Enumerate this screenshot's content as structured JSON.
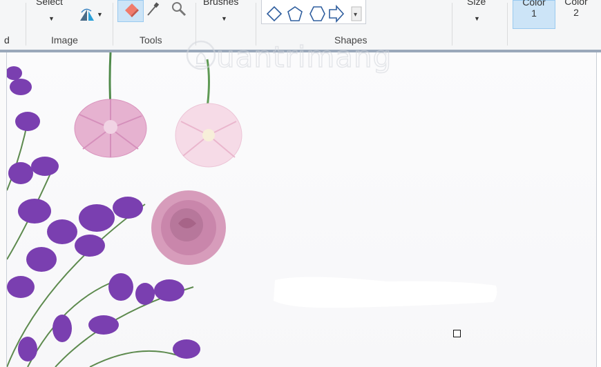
{
  "ribbon": {
    "cut_labels": {
      "select": "Select",
      "brushes": "Brushes",
      "size": "Size",
      "color1_label": "Color",
      "color1_num": "1",
      "color2_label": "Color",
      "color2_num": "2",
      "left_cut": "d"
    },
    "groups": {
      "image": "Image",
      "tools": "Tools",
      "shapes": "Shapes"
    }
  },
  "watermark": {
    "text": "uantrimang"
  },
  "colors": {
    "ribbon_bg": "#f5f6f7",
    "ribbon_border": "#9aa8ba",
    "color_selected": "#cce4f7"
  }
}
